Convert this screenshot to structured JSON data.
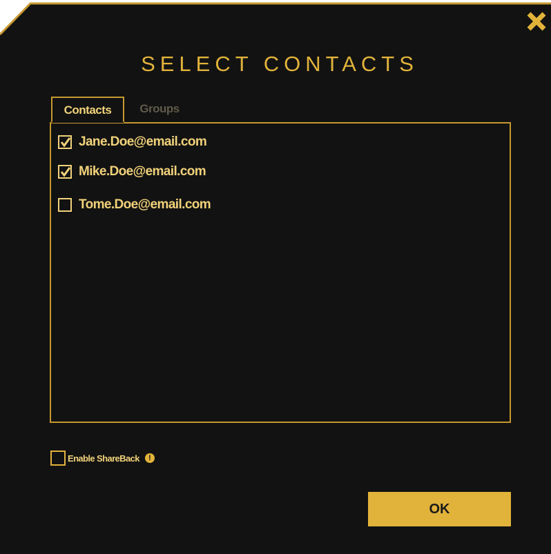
{
  "dialog": {
    "title": "SELECT CONTACTS",
    "close_icon": "close-icon"
  },
  "tabs": [
    {
      "label": "Contacts",
      "active": true
    },
    {
      "label": "Groups",
      "active": false
    }
  ],
  "contacts": [
    {
      "email": "Jane.Doe@email.com",
      "checked": true
    },
    {
      "email": "Mike.Doe@email.com",
      "checked": true
    },
    {
      "email": "Tome.Doe@email.com",
      "checked": false
    }
  ],
  "shareback": {
    "label": "Enable ShareBack",
    "checked": false,
    "info_icon": "info-icon",
    "info_glyph": "!"
  },
  "ok_button": {
    "label": "OK"
  },
  "colors": {
    "background": "#121212",
    "accent": "#e2b33b",
    "text": "#f1d27a",
    "border": "#c79a2f",
    "inactive_tab": "#5f5a4a"
  }
}
